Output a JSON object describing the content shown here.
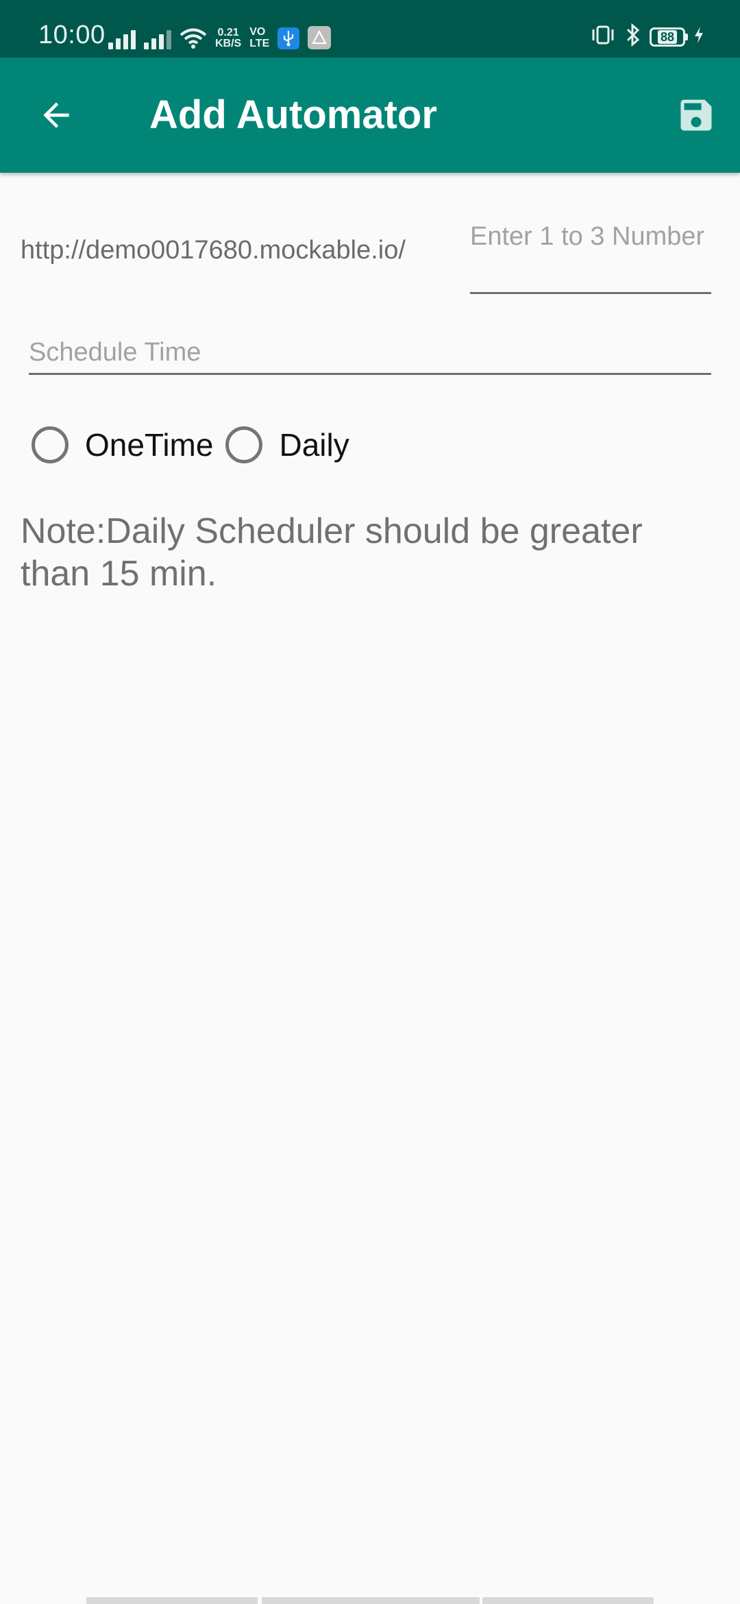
{
  "status_bar": {
    "time": "10:00",
    "net_speed_value": "0.21",
    "net_speed_unit": "KB/S",
    "volte_top": "VO",
    "volte_bottom": "LTE",
    "battery": "88"
  },
  "app_bar": {
    "title": "Add Automator",
    "back_icon": "arrow-back-icon",
    "save_icon": "save-icon",
    "color": "#008577",
    "status_color": "#00574b"
  },
  "form": {
    "url_prefix": "http://demo0017680.mockable.io/",
    "number_placeholder": "Enter 1 to 3 Number",
    "number_value": "",
    "schedule_placeholder": "Schedule Time",
    "schedule_value": "",
    "radio_options": [
      {
        "label": "OneTime",
        "selected": false
      },
      {
        "label": "Daily",
        "selected": false
      }
    ],
    "note": "Note:Daily Scheduler should be greater than 15 min."
  }
}
